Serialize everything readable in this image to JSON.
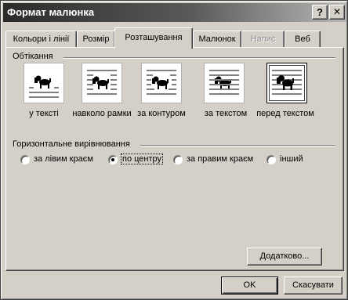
{
  "window": {
    "title": "Формат малюнка",
    "help_glyph": "?",
    "close_glyph": "✕"
  },
  "tabs": [
    {
      "label": "Кольори і лінії",
      "active": false,
      "disabled": false
    },
    {
      "label": "Розмір",
      "active": false,
      "disabled": false
    },
    {
      "label": "Розташування",
      "active": true,
      "disabled": false
    },
    {
      "label": "Малюнок",
      "active": false,
      "disabled": false
    },
    {
      "label": "Напис",
      "active": false,
      "disabled": true
    },
    {
      "label": "Веб",
      "active": false,
      "disabled": false
    }
  ],
  "wrapping": {
    "title": "Обтікання",
    "options": [
      {
        "label": "у тексті",
        "icon": "inline-with-text-icon",
        "selected": false
      },
      {
        "label": "навколо рамки",
        "icon": "square-wrap-icon",
        "selected": false
      },
      {
        "label": "за контуром",
        "icon": "tight-wrap-icon",
        "selected": false
      },
      {
        "label": "за текстом",
        "icon": "behind-text-icon",
        "selected": false
      },
      {
        "label": "перед текстом",
        "icon": "in-front-of-text-icon",
        "selected": true
      }
    ]
  },
  "alignment": {
    "title": "Горизонтальне вирівнювання",
    "options": [
      {
        "label": "за лівим краєм",
        "selected": false
      },
      {
        "label": "по центру",
        "selected": true
      },
      {
        "label": "за правим краєм",
        "selected": false
      },
      {
        "label": "інший",
        "selected": false
      }
    ]
  },
  "buttons": {
    "advanced": "Додатково...",
    "ok": "OK",
    "cancel": "Скасувати"
  }
}
